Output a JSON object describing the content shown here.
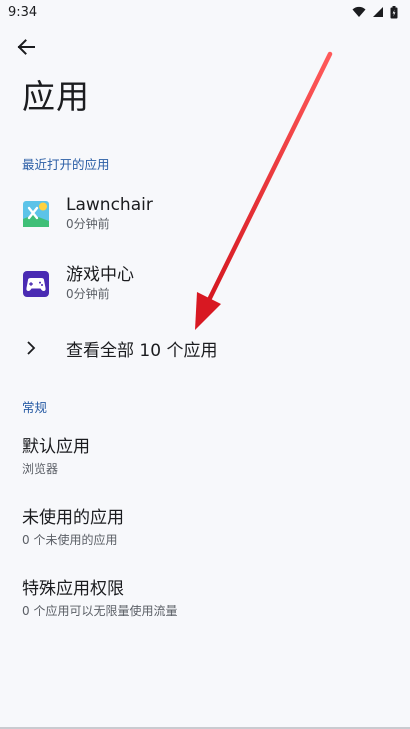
{
  "status_bar": {
    "time": "9:34",
    "icons": [
      "wifi-icon",
      "signal-icon",
      "battery-icon"
    ]
  },
  "header": {
    "back_icon": "arrow-back-icon",
    "title": "应用"
  },
  "recent_section": {
    "header": "最近打开的应用",
    "apps": [
      {
        "name": "Lawnchair",
        "subtitle": "0分钟前",
        "icon": "lawnchair-icon"
      },
      {
        "name": "游戏中心",
        "subtitle": "0分钟前",
        "icon": "game-center-icon"
      }
    ],
    "see_all_label": "查看全部 10 个应用"
  },
  "general_section": {
    "header": "常规",
    "items": [
      {
        "title": "默认应用",
        "subtitle": "浏览器"
      },
      {
        "title": "未使用的应用",
        "subtitle": "0 个未使用的应用"
      },
      {
        "title": "特殊应用权限",
        "subtitle": "0 个应用可以无限量使用流量"
      }
    ]
  },
  "colors": {
    "accent": "#2a5da5",
    "annotation_arrow": "#e8141c"
  }
}
